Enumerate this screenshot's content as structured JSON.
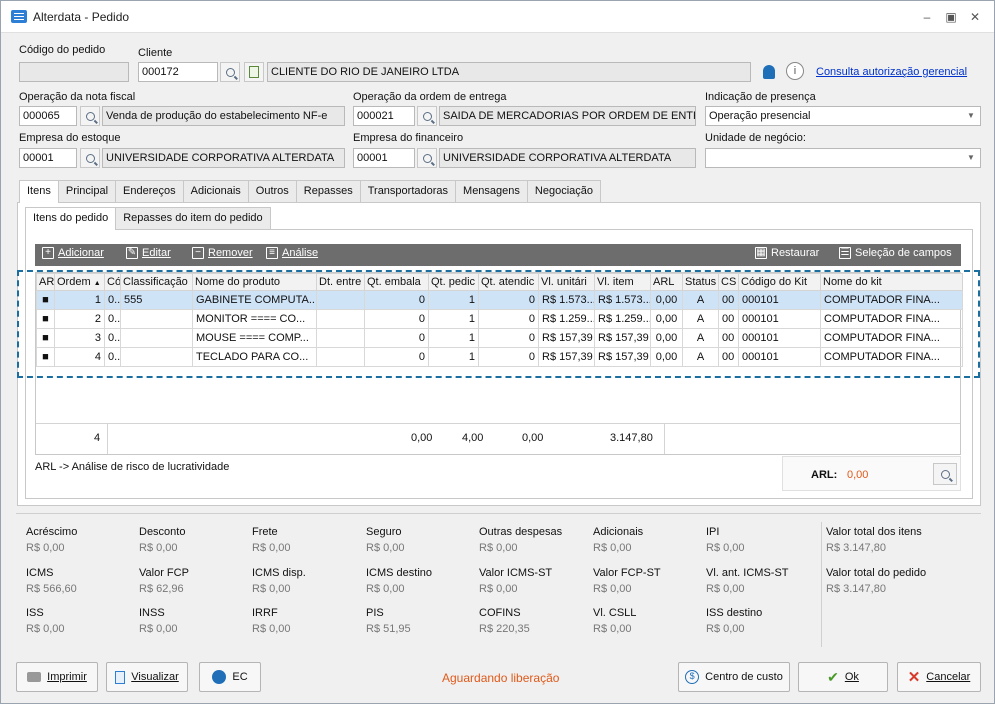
{
  "window": {
    "title": "Alterdata - Pedido"
  },
  "header": {
    "codigo_pedido_label": "Código do pedido",
    "codigo_pedido_value": "",
    "cliente_label": "Cliente",
    "cliente_code": "000172",
    "cliente_name": "CLIENTE DO RIO DE JANEIRO LTDA",
    "consulta_link": "Consulta autorização gerencial",
    "op_nota_label": "Operação da nota fiscal",
    "op_nota_code": "000065",
    "op_nota_desc": "Venda de produção do estabelecimento NF-e",
    "op_ordem_label": "Operação da ordem de entrega",
    "op_ordem_code": "000021",
    "op_ordem_desc": "SAIDA DE MERCADORIAS POR ORDEM DE ENTRE",
    "presenca_label": "Indicação de presença",
    "presenca_value": "Operação presencial",
    "empresa_estoque_label": "Empresa do estoque",
    "empresa_estoque_code": "00001",
    "empresa_estoque_name": "UNIVERSIDADE CORPORATIVA ALTERDATA",
    "empresa_fin_label": "Empresa do financeiro",
    "empresa_fin_code": "00001",
    "empresa_fin_name": "UNIVERSIDADE CORPORATIVA ALTERDATA",
    "unidade_label": "Unidade de negócio:",
    "unidade_value": ""
  },
  "tabs": [
    "Itens",
    "Principal",
    "Endereços",
    "Adicionais",
    "Outros",
    "Repasses",
    "Transportadoras",
    "Mensagens",
    "Negociação"
  ],
  "subtabs": [
    "Itens do pedido",
    "Repasses do item do pedido"
  ],
  "toolbar": {
    "adicionar": "Adicionar",
    "editar": "Editar",
    "remover": "Remover",
    "analise": "Análise",
    "restaurar": "Restaurar",
    "selecao": "Seleção de campos"
  },
  "grid": {
    "columns": [
      "AR",
      "Ordem",
      "Cóc",
      "Classificação",
      "Nome do produto",
      "Dt. entre",
      "Qt. embala",
      "Qt. pedic",
      "Qt. atendic",
      "Vl. unitári",
      "Vl. item",
      "ARL",
      "Status",
      "CS",
      "Código do Kit",
      "Nome do kit"
    ],
    "rows": [
      [
        "■",
        "1",
        "0...",
        "555",
        "GABINETE COMPUTA...",
        "",
        "0",
        "1",
        "0",
        "R$ 1.573...",
        "R$ 1.573...",
        "0,00",
        "A",
        "00",
        "000101",
        "COMPUTADOR FINA..."
      ],
      [
        "■",
        "2",
        "0...",
        "",
        "MONITOR ==== CO...",
        "",
        "0",
        "1",
        "0",
        "R$ 1.259...",
        "R$ 1.259...",
        "0,00",
        "A",
        "00",
        "000101",
        "COMPUTADOR FINA..."
      ],
      [
        "■",
        "3",
        "0...",
        "",
        "MOUSE ==== COMP...",
        "",
        "0",
        "1",
        "0",
        "R$ 157,39",
        "R$ 157,39",
        "0,00",
        "A",
        "00",
        "000101",
        "COMPUTADOR FINA..."
      ],
      [
        "■",
        "4",
        "0...",
        "",
        "TECLADO PARA CO...",
        "",
        "0",
        "1",
        "0",
        "R$ 157,39",
        "R$ 157,39",
        "0,00",
        "A",
        "00",
        "000101",
        "COMPUTADOR FINA..."
      ]
    ],
    "totals": {
      "count": "4",
      "qt_embala": "0,00",
      "qt_pedido": "4,00",
      "qt_atendido": "0,00",
      "vl_item": "3.147,80"
    }
  },
  "arl": {
    "legend": "ARL -> Análise de risco de lucratividade",
    "label": "ARL:",
    "value": "0,00"
  },
  "summary": [
    {
      "label": "Acréscimo",
      "value": "R$ 0,00"
    },
    {
      "label": "Desconto",
      "value": "R$ 0,00"
    },
    {
      "label": "Frete",
      "value": "R$ 0,00"
    },
    {
      "label": "Seguro",
      "value": "R$ 0,00"
    },
    {
      "label": "Outras despesas",
      "value": "R$ 0,00"
    },
    {
      "label": "Adicionais",
      "value": "R$ 0,00"
    },
    {
      "label": "IPI",
      "value": "R$ 0,00"
    },
    {
      "label": "ICMS",
      "value": "R$ 566,60"
    },
    {
      "label": "Valor FCP",
      "value": "R$ 62,96"
    },
    {
      "label": "ICMS disp.",
      "value": "R$ 0,00"
    },
    {
      "label": "ICMS destino",
      "value": "R$ 0,00"
    },
    {
      "label": "Valor ICMS-ST",
      "value": "R$ 0,00"
    },
    {
      "label": "Valor FCP-ST",
      "value": "R$ 0,00"
    },
    {
      "label": "Vl. ant. ICMS-ST",
      "value": "R$ 0,00"
    },
    {
      "label": "ISS",
      "value": "R$ 0,00"
    },
    {
      "label": "INSS",
      "value": "R$ 0,00"
    },
    {
      "label": "IRRF",
      "value": "R$ 0,00"
    },
    {
      "label": "PIS",
      "value": "R$ 51,95"
    },
    {
      "label": "COFINS",
      "value": "R$ 220,35"
    },
    {
      "label": "Vl. CSLL",
      "value": "R$ 0,00"
    },
    {
      "label": "ISS destino",
      "value": "R$ 0,00"
    }
  ],
  "totals_right": {
    "itens_label": "Valor total dos itens",
    "itens_value": "R$ 3.147,80",
    "pedido_label": "Valor total do pedido",
    "pedido_value": "R$ 3.147,80"
  },
  "footer": {
    "imprimir": "Imprimir",
    "visualizar": "Visualizar",
    "ec": "EC",
    "status": "Aguardando liberação",
    "centro": "Centro de custo",
    "ok": "Ok",
    "cancelar": "Cancelar"
  },
  "colors": {
    "link": "#0033cc",
    "status": "#e05a1a",
    "selected_row": "#cfe3f7",
    "toolbar": "#6d6d6d",
    "dash": "#1a6fa0"
  }
}
